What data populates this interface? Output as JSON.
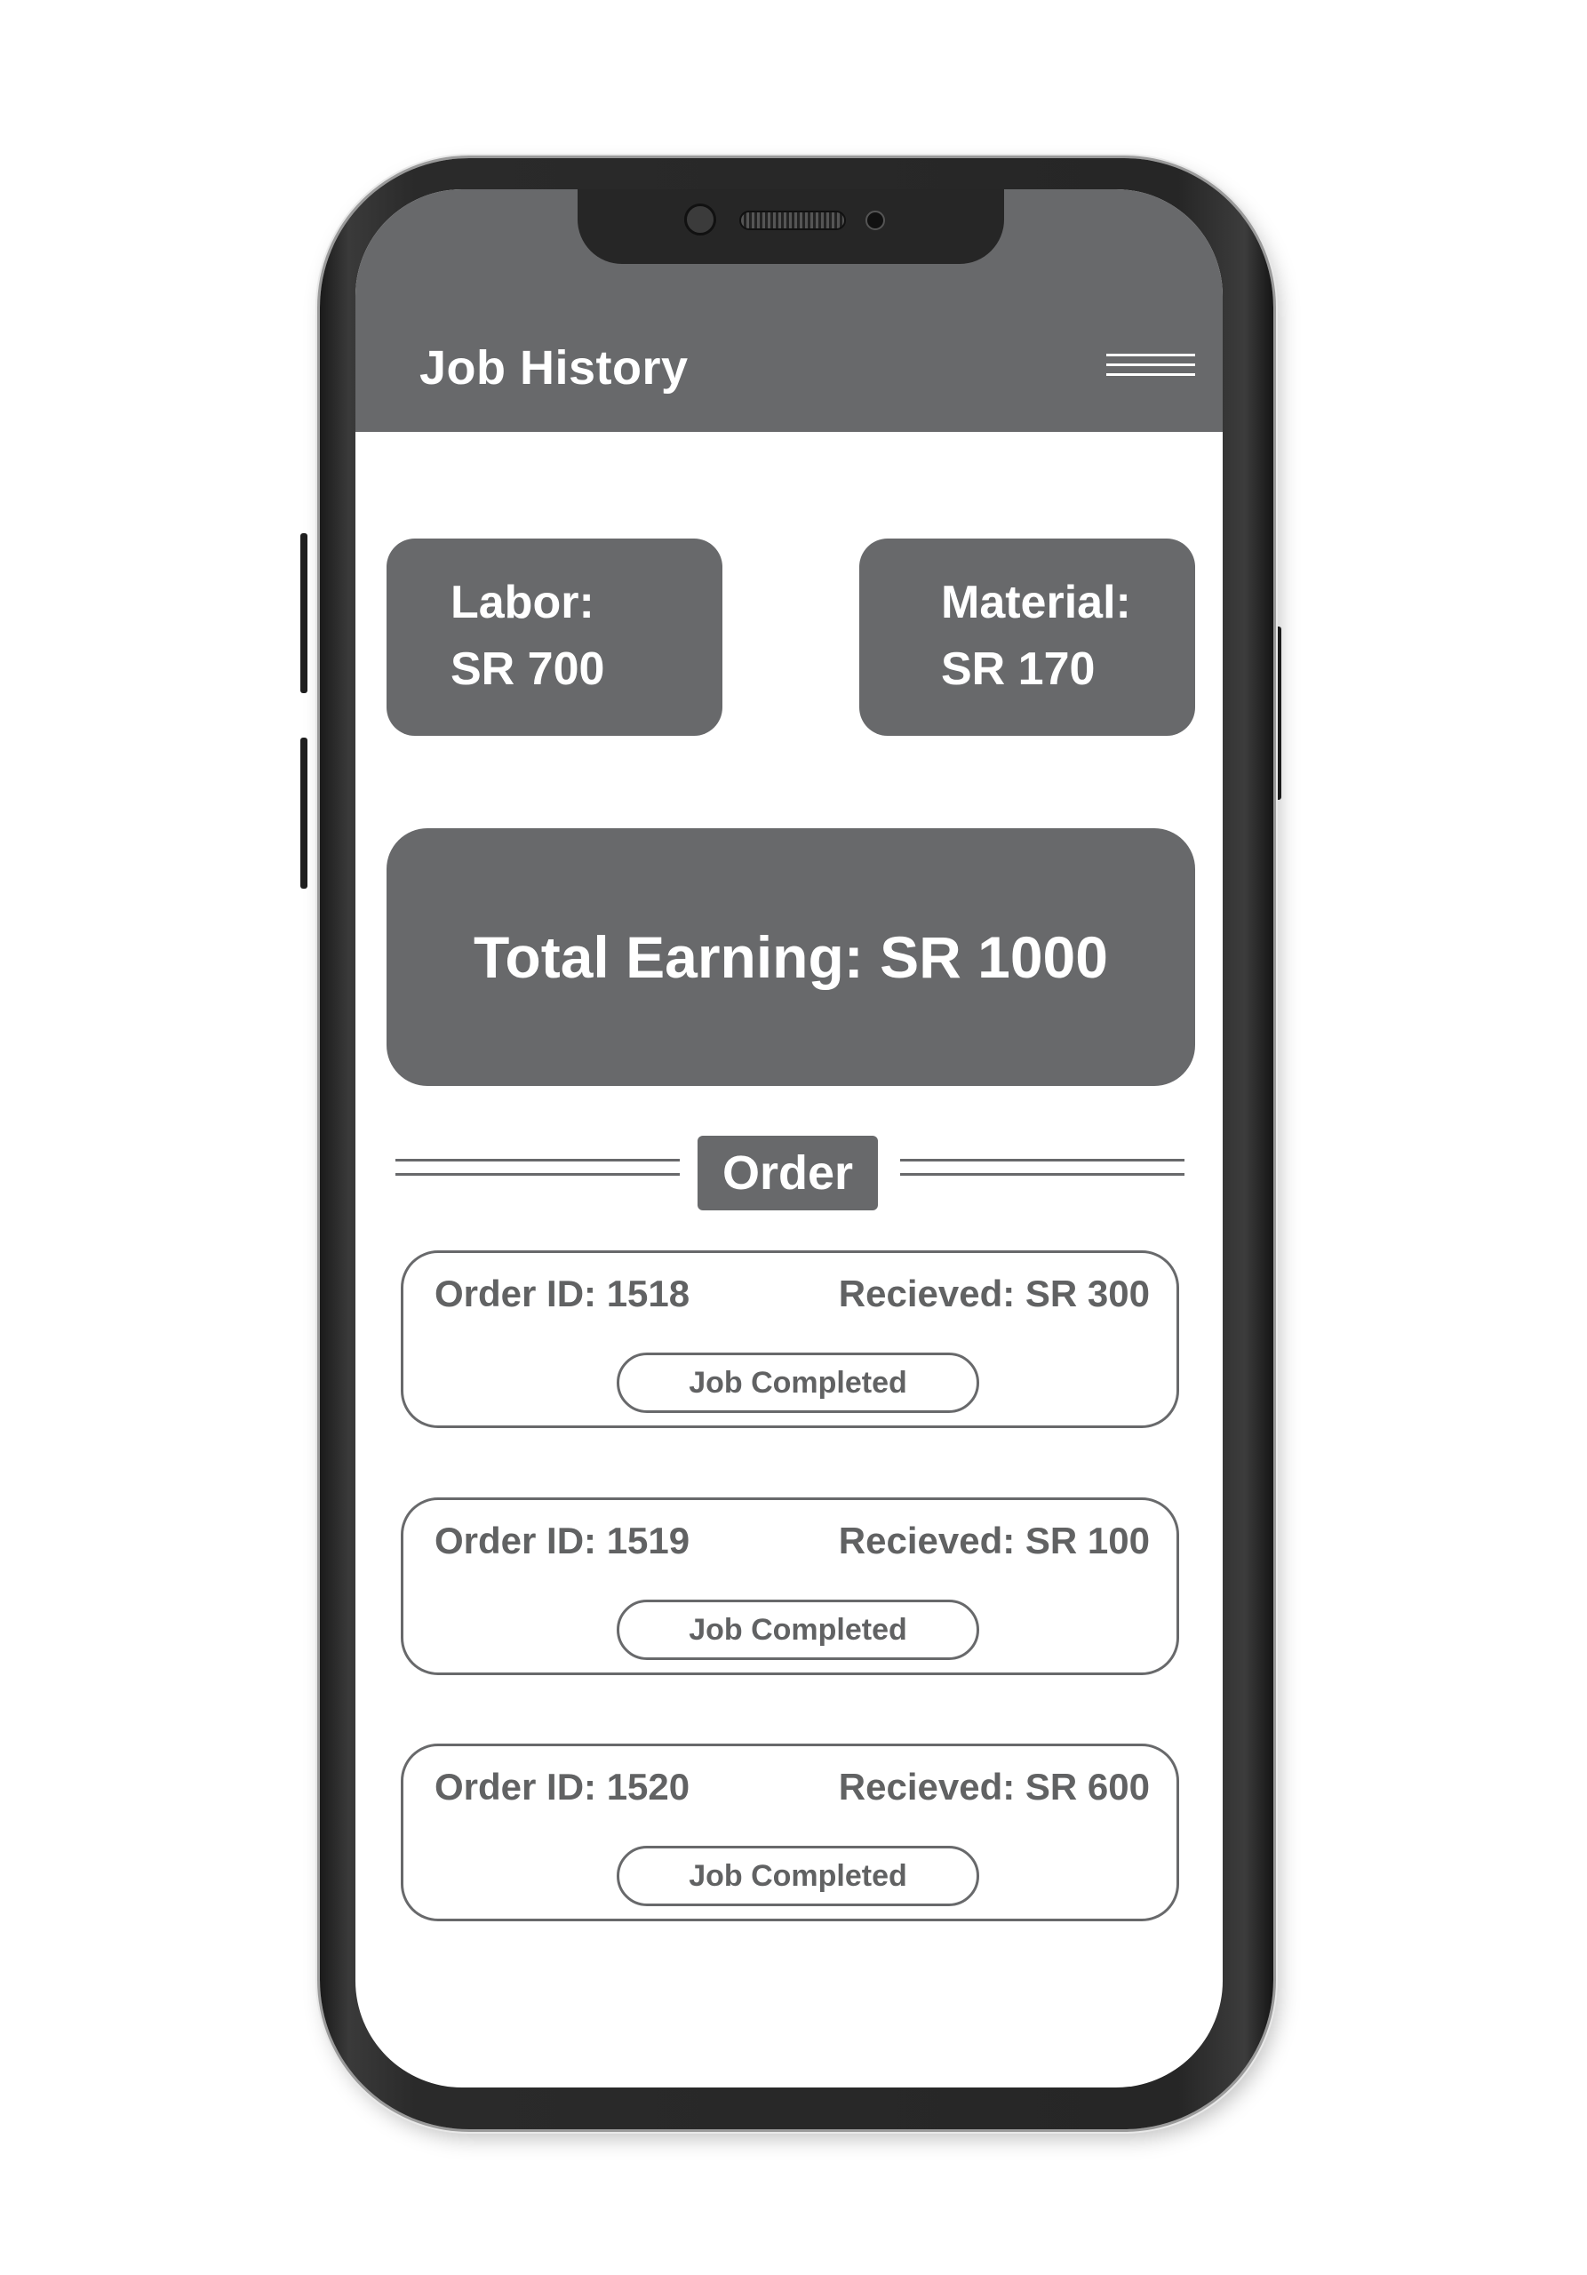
{
  "app": {
    "title": "Job History"
  },
  "summary": {
    "labor_label": "Labor:",
    "labor_value": "SR 700",
    "material_label": "Material:",
    "material_value": "SR 170",
    "total": "Total Earning: SR 1000"
  },
  "orders_section": {
    "label": "Order"
  },
  "orders": [
    {
      "id_text": "Order ID: 1518",
      "received_text": "Recieved: SR 300",
      "status": "Job Completed"
    },
    {
      "id_text": "Order ID: 1519",
      "received_text": "Recieved: SR 100",
      "status": "Job Completed"
    },
    {
      "id_text": "Order ID: 1520",
      "received_text": "Recieved: SR 600",
      "status": "Job Completed"
    }
  ],
  "icons": {
    "menu": "hamburger-menu-icon"
  },
  "colors": {
    "primary_gray": "#68696b",
    "text_gray": "#616263",
    "background": "#ffffff",
    "on_primary": "#ffffff"
  }
}
